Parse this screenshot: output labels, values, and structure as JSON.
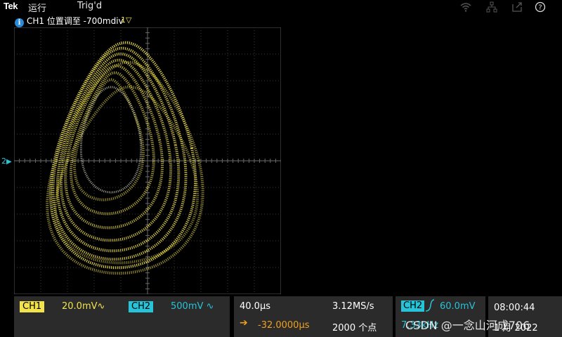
{
  "header": {
    "brand": "Tek",
    "run_state": "运行",
    "trigger_state": "Trig'd",
    "icons": [
      "wifi-icon",
      "network-icon",
      "export-icon",
      "help-icon"
    ],
    "help_glyph": "?"
  },
  "notice": {
    "icon": "i",
    "text": "CH1 位置调至 -700mdiv"
  },
  "markers": {
    "trigger": "1▽",
    "ch2_ground": "2"
  },
  "bottom": {
    "ch1": {
      "label": "CH1",
      "scale": "20.0mV∿"
    },
    "ch2": {
      "label": "CH2",
      "scale": "500mV ∿"
    },
    "horizontal": {
      "time_div": "40.0μs",
      "delay": "-32.0000μs"
    },
    "acq": {
      "sample_rate": "3.12MS/s",
      "record": "2000 个点"
    },
    "trigger": {
      "source": "CH2",
      "level": "60.0mV",
      "freq": "7.33kHz"
    },
    "time": {
      "clock": "08:00:44",
      "date": "1 月 2022"
    }
  },
  "watermark": "CSDN @一念山河成706",
  "colors": {
    "ch1": "#f2e34c",
    "ch2": "#27c3d8",
    "delay": "#f0a020",
    "background": "#000000"
  }
}
